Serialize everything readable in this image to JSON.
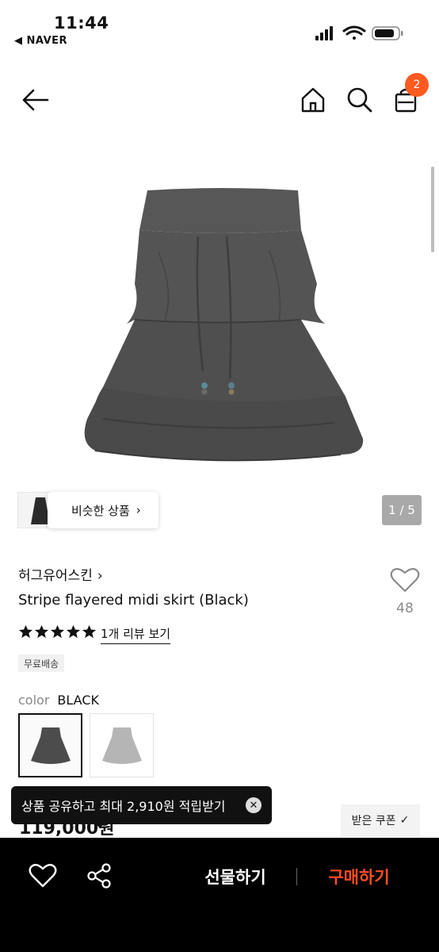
{
  "status_bar": {
    "time": "11:44",
    "back_app": "◀ NAVER",
    "icons": [
      "signal-icon",
      "wifi-icon",
      "battery-icon"
    ]
  },
  "nav": {
    "icons": [
      "back-arrow-icon",
      "home-icon",
      "search-icon",
      "shopping-bag-icon"
    ],
    "bag_badge": "2"
  },
  "gallery": {
    "page_counter": "1 / 5",
    "similar_button": "비슷한 상품"
  },
  "product": {
    "brand": "허그유어스킨",
    "name": "Stripe flayered midi skirt (Black)",
    "wish_count": "48",
    "rating": 5,
    "review_link": "1개 리뷰 보기",
    "free_shipping": "무료배송",
    "color_label": "color",
    "color_value": "BLACK",
    "price_partial": "119,000원"
  },
  "toast": {
    "text": "상품 공유하고 최대 2,910원 적립받기"
  },
  "coupon": {
    "label": "받은 쿠폰"
  },
  "bottom_bar": {
    "gift_label": "선물하기",
    "buy_label": "구매하기"
  },
  "colors": {
    "accent": "#ff5a1f",
    "buy": "#ff4d1f",
    "bar": "#000000"
  }
}
